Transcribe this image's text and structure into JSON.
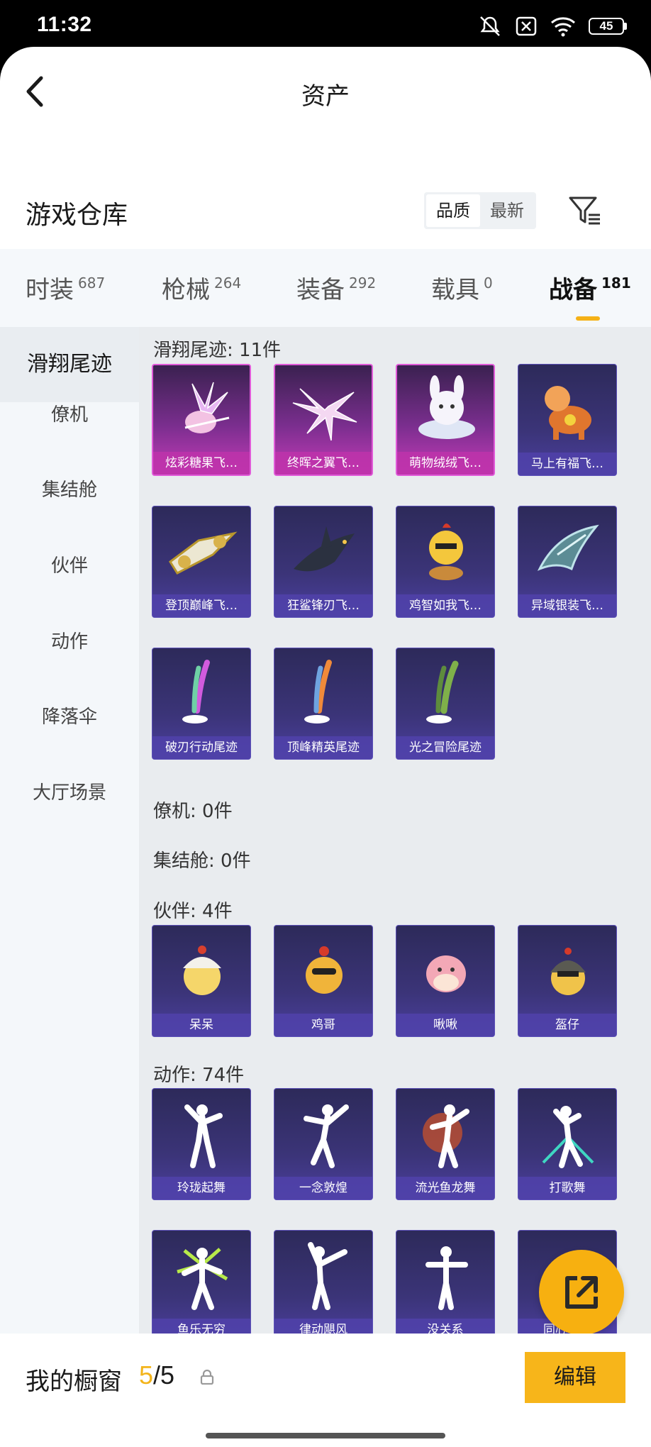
{
  "status": {
    "time": "11:32",
    "battery": "45"
  },
  "header": {
    "title": "资产"
  },
  "warehouse": {
    "title": "游戏仓库",
    "sort_options": [
      "品质",
      "最新"
    ]
  },
  "tabs": [
    {
      "label": "时装",
      "count": "687"
    },
    {
      "label": "枪械",
      "count": "264"
    },
    {
      "label": "装备",
      "count": "292"
    },
    {
      "label": "载具",
      "count": "0"
    },
    {
      "label": "战备",
      "count": "181"
    }
  ],
  "sidebar": {
    "items": [
      "滑翔尾迹",
      "僚机",
      "集结舱",
      "伙伴",
      "动作",
      "降落伞",
      "大厅场景"
    ]
  },
  "sections": [
    {
      "title": "滑翔尾迹: 11件",
      "items": [
        "炫彩糖果飞…",
        "终晖之翼飞…",
        "萌物绒绒飞…",
        "马上有福飞…",
        "登顶巅峰飞…",
        "狂鲨锋刃飞…",
        "鸡智如我飞…",
        "异域银装飞…",
        "破刃行动尾迹",
        "顶峰精英尾迹",
        "光之冒险尾迹"
      ]
    },
    {
      "title": "僚机: 0件",
      "items": []
    },
    {
      "title": "集结舱: 0件",
      "items": []
    },
    {
      "title": "伙伴: 4件",
      "items": [
        "呆呆",
        "鸡哥",
        "啾啾",
        "盔仔"
      ]
    },
    {
      "title": "动作: 74件",
      "items": [
        "玲珑起舞",
        "一念敦煌",
        "流光鱼龙舞",
        "打歌舞",
        "鱼乐无穷",
        "律动飓风",
        "没关系",
        "同心登峰"
      ]
    }
  ],
  "bottom": {
    "label": "我的橱窗",
    "current": "5",
    "total": "/5",
    "edit": "编辑"
  },
  "colors": {
    "accent": "#f7b51a",
    "epic": "#c33bb7",
    "rare": "#4b3f9e"
  }
}
